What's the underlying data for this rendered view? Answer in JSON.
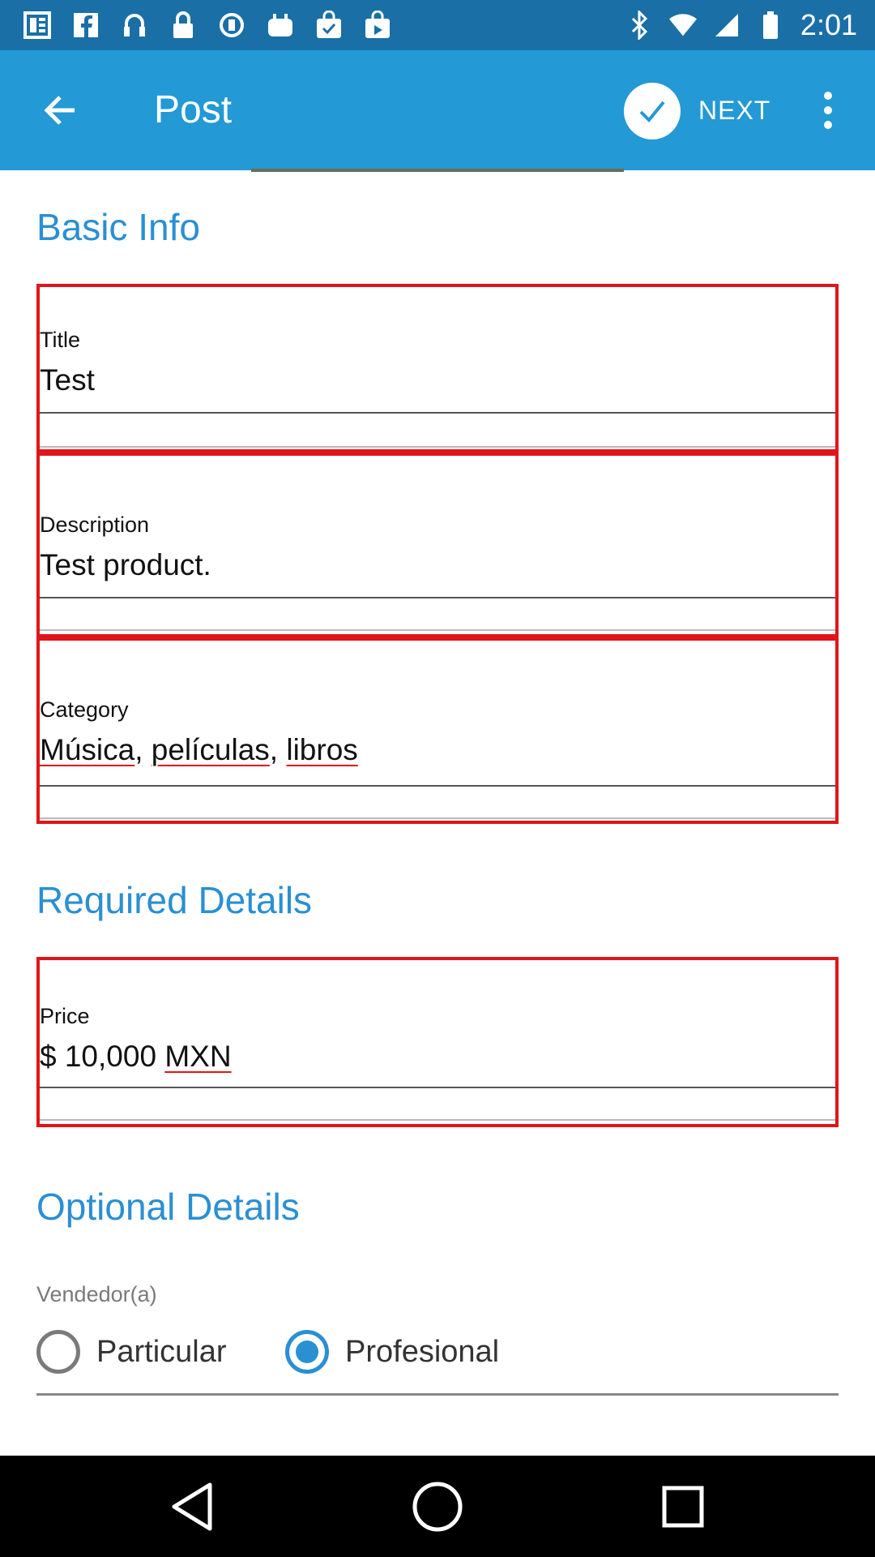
{
  "status_bar": {
    "time": "2:01",
    "left_icons": [
      "news-icon",
      "facebook-icon",
      "podcast-icon",
      "lock-icon",
      "sync-icon",
      "bag-icon",
      "shopping-bag-check-icon",
      "shopping-bag-icon"
    ],
    "right_icons": [
      "bluetooth-icon",
      "wifi-icon",
      "signal-icon",
      "battery-icon"
    ]
  },
  "app_bar": {
    "title": "Post",
    "next_label": "NEXT",
    "colors": {
      "app_bar": "#2399d6",
      "status_bar": "#1a6fa6",
      "accent": "#2a8fd3",
      "error": "#e0151b"
    }
  },
  "sections": {
    "basic_info": "Basic Info",
    "required_details": "Required Details",
    "optional_details": "Optional Details"
  },
  "fields": {
    "title": {
      "label": "Title",
      "value": "Test"
    },
    "description": {
      "label": "Description",
      "value": "Test product."
    },
    "category": {
      "label": "Category",
      "parts": [
        "Música",
        ", ",
        "películas",
        ", ",
        "libros"
      ]
    },
    "price": {
      "label": "Price",
      "prefix": "$ 10,000 ",
      "currency": "MXN"
    }
  },
  "seller": {
    "label": "Vendedor(a)",
    "options": [
      {
        "label": "Particular",
        "selected": false
      },
      {
        "label": "Profesional",
        "selected": true
      }
    ]
  },
  "nav": {
    "buttons": [
      "back-nav-icon",
      "home-nav-icon",
      "recents-nav-icon"
    ]
  }
}
